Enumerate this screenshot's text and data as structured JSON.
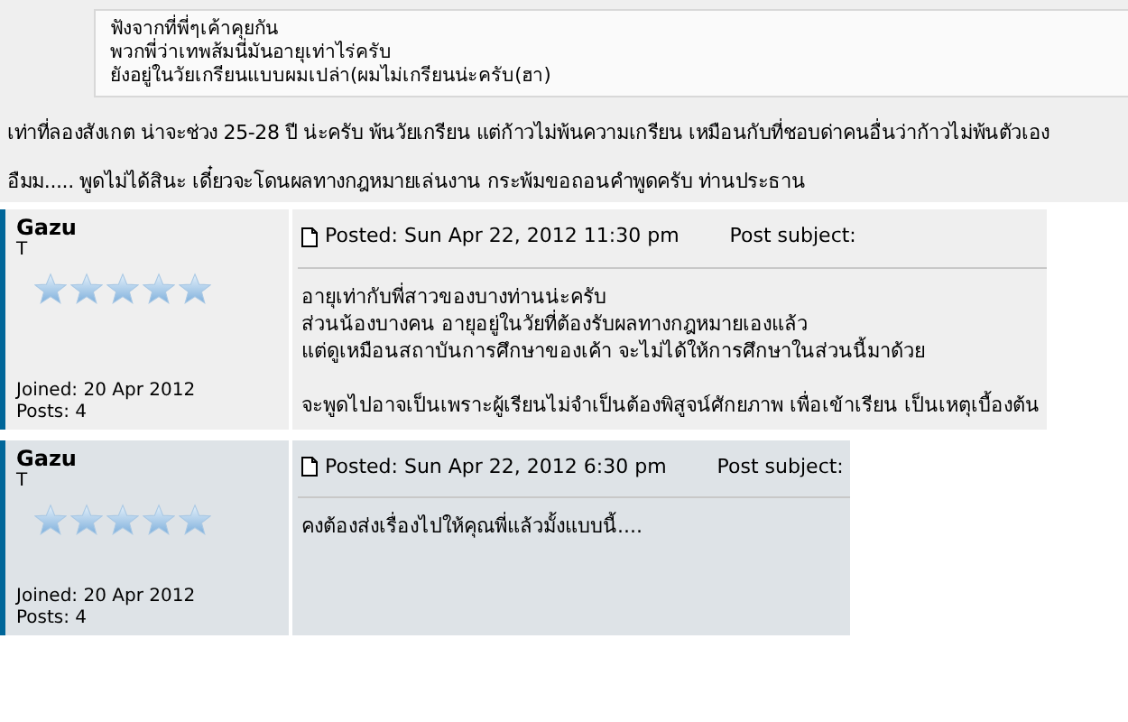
{
  "quote": {
    "lines": [
      "ฟังจากที่พี่ๆเค้าคุยกัน",
      "พวกพี่ว่าเทพส้มนี่มันอายุเท่าไร่ครับ",
      "ยังอยู่ในวัยเกรียนแบบผมเปล่า(ผมไม่เกรียนน่ะครับ(ฮา)"
    ]
  },
  "paragraphs": [
    "เท่าที่ลองสังเกต น่าจะช่วง 25-28 ปี น่ะครับ พ้นวัยเกรียน แต่ก้าวไม่พ้นความเกรียน เหมือนกับที่ชอบด่าคนอื่นว่าก้าวไม่พ้นตัวเอง",
    "อืมม..... พูดไม่ได้สินะ เดี๋ยวจะโดนผลทางกฎหมายเล่นงาน กระพ้มขอถอนคำพูดครับ ท่านประธาน"
  ],
  "posts": [
    {
      "author": "Gazu",
      "rank": "T",
      "stars": 5,
      "joined": "Joined: 20 Apr 2012",
      "posts": "Posts: 4",
      "posted": "Posted: Sun Apr 22, 2012 11:30 pm",
      "subject": "Post subject:",
      "body": [
        [
          "อายุเท่ากับพี่สาวของบางท่านน่ะครับ",
          "ส่วนน้องบางคน อายุอยู่ในวัยที่ต้องรับผลทางกฎหมายเองแล้ว",
          "แต่ดูเหมือนสถาบันการศึกษาของเค้า จะไม่ได้ให้การศึกษาในส่วนนี้มาด้วย"
        ],
        [
          "จะพูดไปอาจเป็นเพราะผู้เรียนไม่จำเป็นต้องพิสูจน์ศักยภาพ เพื่อเข้าเรียน เป็นเหตุเบื้องต้น"
        ]
      ]
    },
    {
      "author": "Gazu",
      "rank": "T",
      "stars": 5,
      "joined": "Joined: 20 Apr 2012",
      "posts": "Posts: 4",
      "posted": "Posted: Sun Apr 22, 2012 6:30 pm",
      "subject": "Post subject:",
      "body": [
        [
          "คงต้องส่งเรื่องไปให้คุณพี่แล้วมั้งแบบนี้...."
        ]
      ]
    }
  ]
}
